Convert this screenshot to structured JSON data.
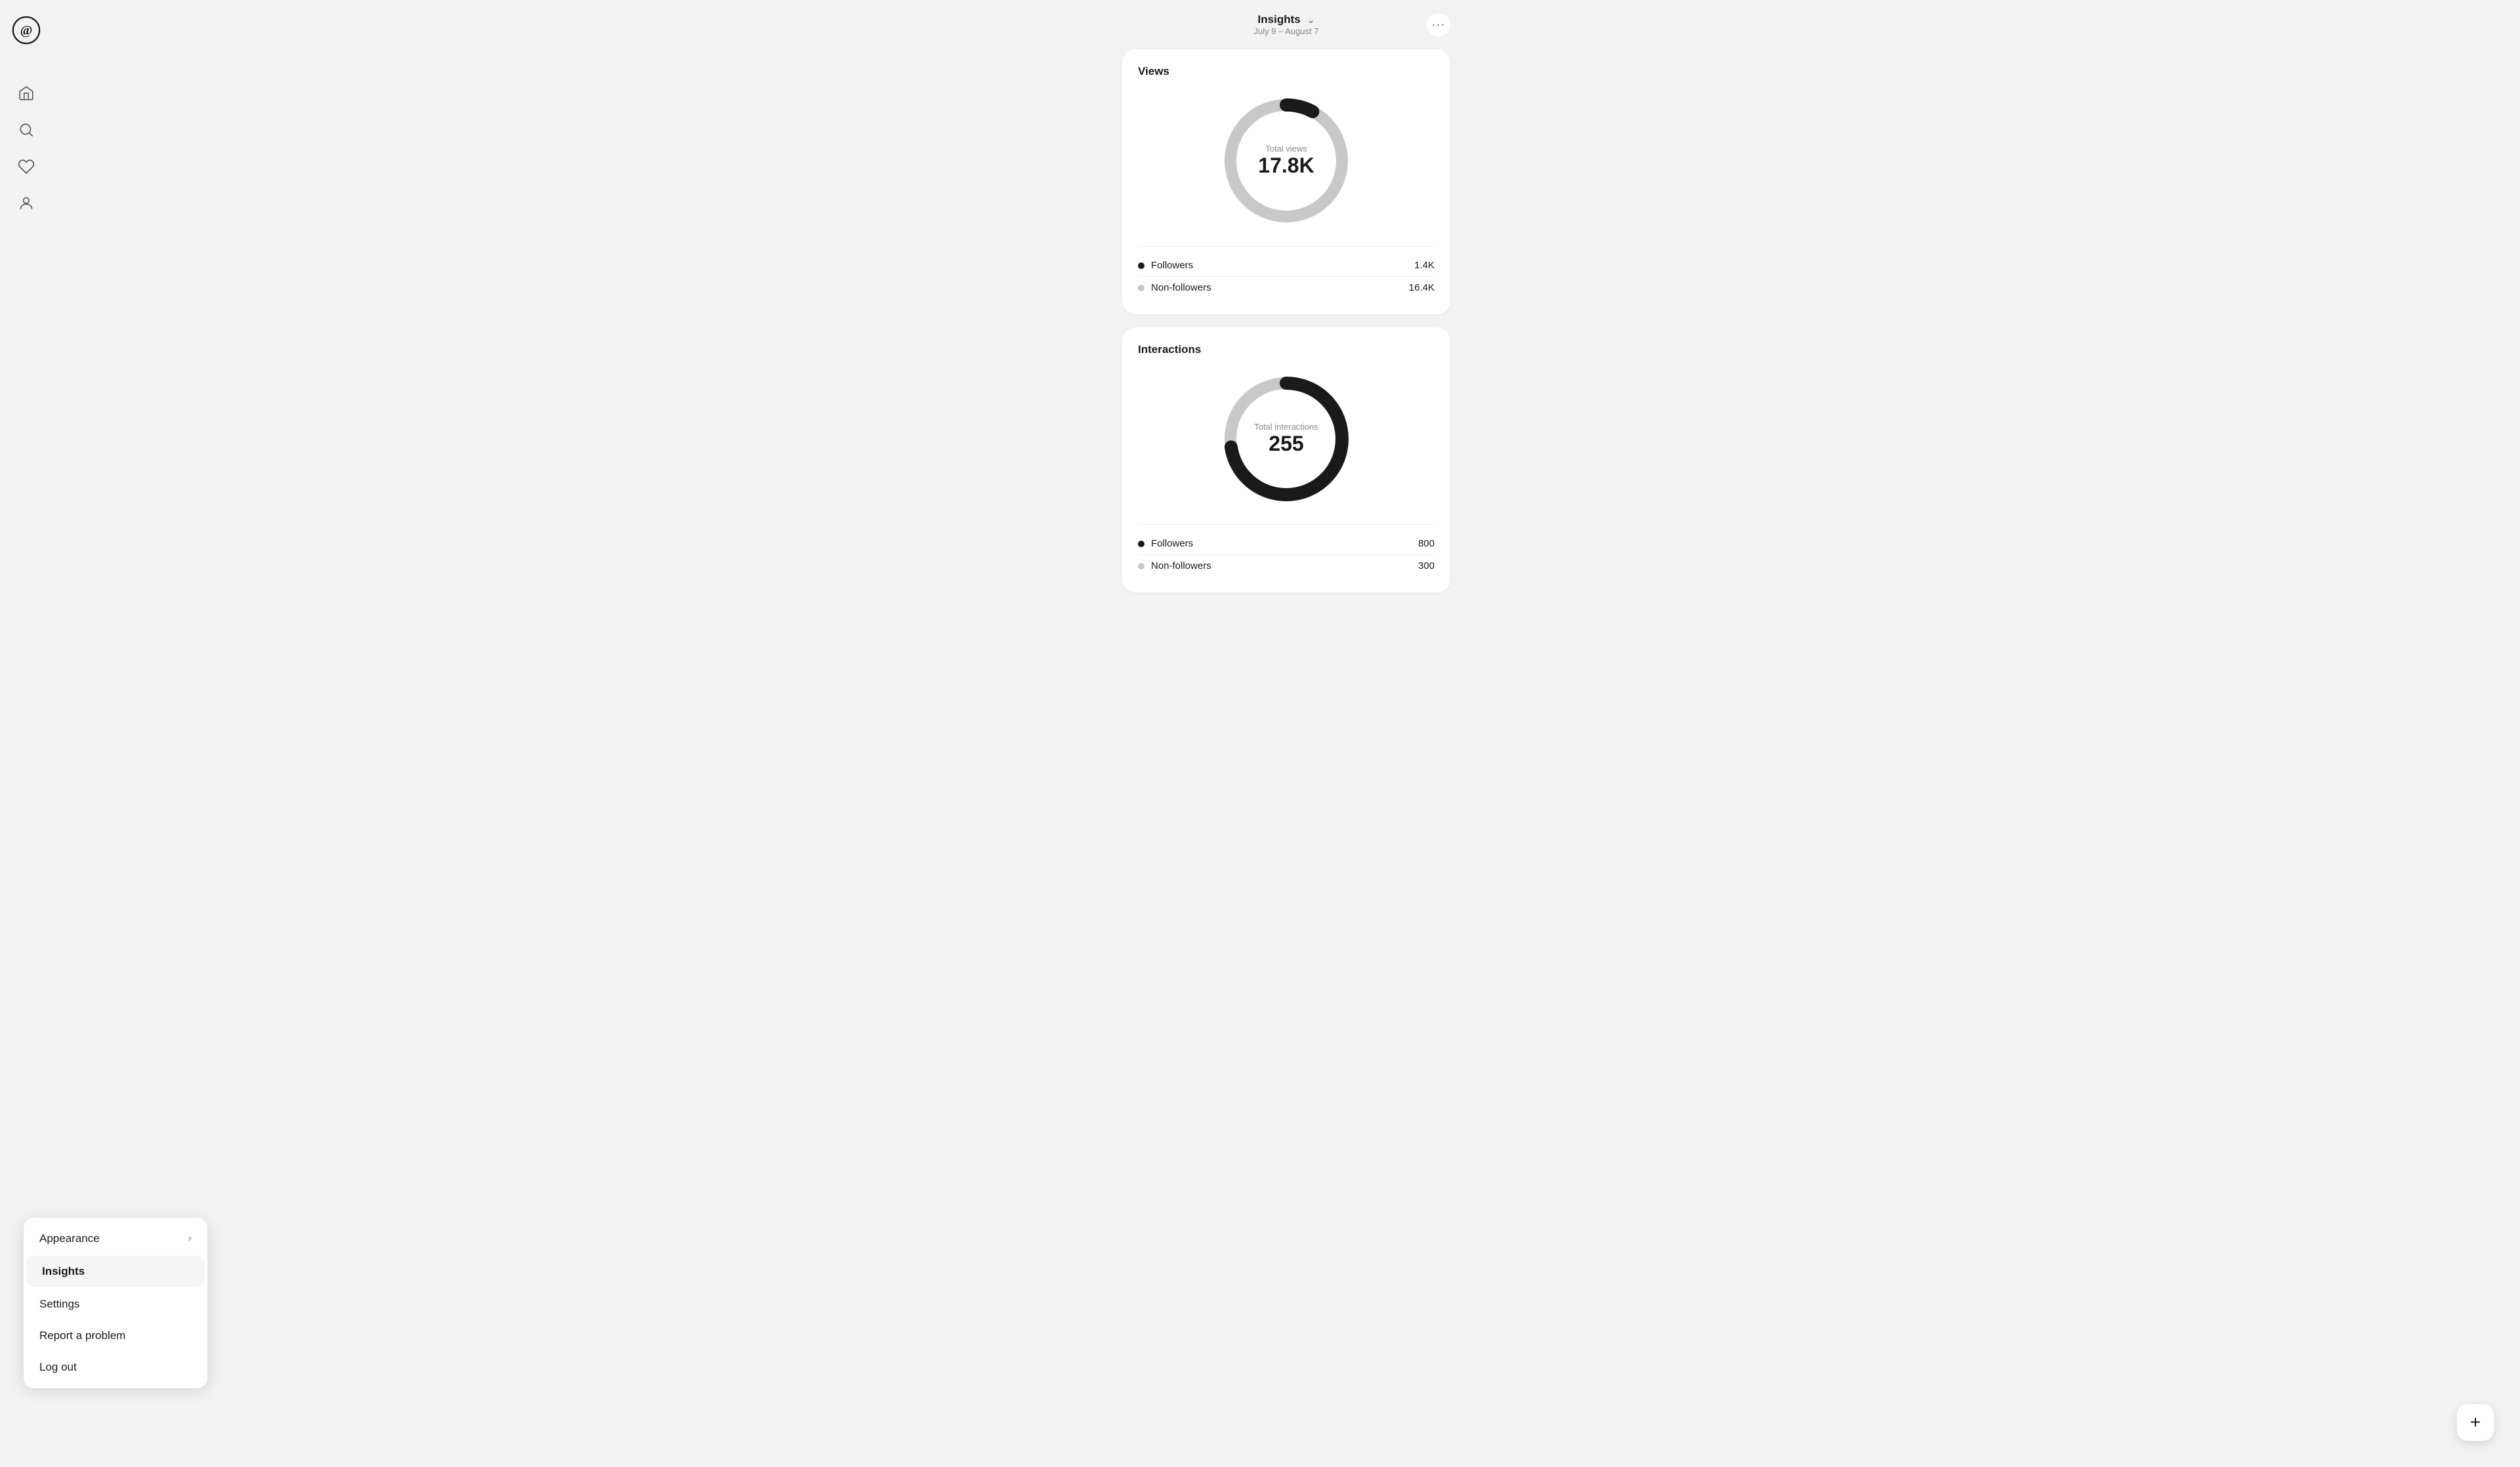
{
  "app": {
    "logo_alt": "Threads"
  },
  "sidebar": {
    "nav_items": [
      {
        "name": "home",
        "label": "Home"
      },
      {
        "name": "search",
        "label": "Search"
      },
      {
        "name": "activity",
        "label": "Activity"
      },
      {
        "name": "profile",
        "label": "Profile"
      }
    ]
  },
  "context_menu": {
    "items": [
      {
        "id": "appearance",
        "label": "Appearance",
        "has_chevron": true
      },
      {
        "id": "insights",
        "label": "Insights",
        "has_chevron": false,
        "active": true
      },
      {
        "id": "settings",
        "label": "Settings",
        "has_chevron": false
      },
      {
        "id": "report",
        "label": "Report a problem",
        "has_chevron": false
      },
      {
        "id": "logout",
        "label": "Log out",
        "has_chevron": false
      }
    ]
  },
  "header": {
    "title": "Insights",
    "subtitle": "July 9 – August 7",
    "more_icon": "•••"
  },
  "views_card": {
    "title": "Views",
    "donut": {
      "label": "Total views",
      "value": "17.8K",
      "followers_pct": 7.9,
      "non_followers_pct": 92.1,
      "followers_color": "#1a1a1a",
      "non_followers_color": "#c8c8c8"
    },
    "legend": [
      {
        "label": "Followers",
        "value": "1.4K",
        "color": "#1a1a1a"
      },
      {
        "label": "Non-followers",
        "value": "16.4K",
        "color": "#c8c8c8"
      }
    ]
  },
  "interactions_card": {
    "title": "Interactions",
    "donut": {
      "label": "Total interactions",
      "value": "255",
      "followers_pct": 72.7,
      "non_followers_pct": 27.3,
      "followers_color": "#1a1a1a",
      "non_followers_color": "#c8c8c8"
    },
    "legend": [
      {
        "label": "Followers",
        "value": "800",
        "color": "#1a1a1a"
      },
      {
        "label": "Non-followers",
        "value": "300",
        "color": "#c8c8c8"
      }
    ]
  },
  "fab": {
    "icon": "+"
  }
}
